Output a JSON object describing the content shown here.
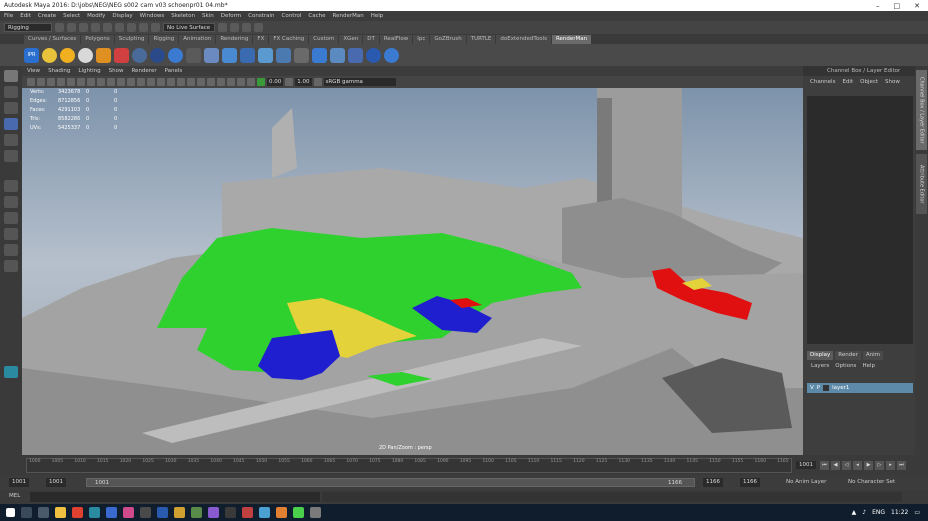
{
  "window": {
    "title": "Autodesk Maya 2016: D:\\jobs\\NEG\\NEG s002 cam v03 schoenpr01 04.mb*"
  },
  "menubar": [
    "File",
    "Edit",
    "Create",
    "Select",
    "Modify",
    "Display",
    "Windows",
    "Skeleton",
    "Skin",
    "Deform",
    "Constrain",
    "Control",
    "Cache",
    "RenderMan",
    "Help"
  ],
  "modebar": {
    "mode": "Rigging",
    "live_surface": "No Live Surface"
  },
  "shelf_tabs": [
    "Curves / Surfaces",
    "Polygons",
    "Sculpting",
    "Rigging",
    "Animation",
    "Rendering",
    "FX",
    "FX Caching",
    "Custom",
    "XGen",
    "DT",
    "RealFlow",
    "Ipc",
    "GoZBrush",
    "TURTLE",
    "doExtendedTools",
    "RenderMan"
  ],
  "shelf_active": "RenderMan",
  "shelf_ipr": "IPR",
  "viewport": {
    "menu": [
      "View",
      "Shading",
      "Lighting",
      "Show",
      "Renderer",
      "Panels"
    ],
    "exposure": "0.00",
    "gamma": "1.00",
    "color_space": "sRGB gamma",
    "hud": [
      {
        "label": "Verts:",
        "a": "3423678",
        "b": "0",
        "c": "0"
      },
      {
        "label": "Edges:",
        "a": "8712856",
        "b": "0",
        "c": "0"
      },
      {
        "label": "Faces:",
        "a": "4291103",
        "b": "0",
        "c": "0"
      },
      {
        "label": "Tris:",
        "a": "8582286",
        "b": "0",
        "c": "0"
      },
      {
        "label": "UVs:",
        "a": "5425337",
        "b": "0",
        "c": "0"
      }
    ],
    "camera_label": "2D Pan/Zoom : persp"
  },
  "channel_box": {
    "title": "Channel Box / Layer Editor",
    "menu": [
      "Channels",
      "Edit",
      "Object",
      "Show"
    ]
  },
  "layer_editor": {
    "tabs": [
      "Display",
      "Render",
      "Anim"
    ],
    "menu": [
      "Layers",
      "Options",
      "Help"
    ],
    "v": "V",
    "p": "P",
    "layer_name": "layer1"
  },
  "side_tabs": [
    "Channel Box / Layer Editor",
    "Attribute Editor"
  ],
  "timeline": {
    "ticks": [
      "1000",
      "1005",
      "1010",
      "1015",
      "1020",
      "1025",
      "1030",
      "1035",
      "1040",
      "1045",
      "1050",
      "1055",
      "1060",
      "1065",
      "1070",
      "1075",
      "1080",
      "1085",
      "1090",
      "1095",
      "1100",
      "1105",
      "1110",
      "1115",
      "1120",
      "1125",
      "1130",
      "1135",
      "1140",
      "1145",
      "1150",
      "1155",
      "1160",
      "1165"
    ],
    "current": "1001"
  },
  "range": {
    "start": "1001",
    "start_inner": "1001",
    "bar_start": "1001",
    "bar_end": "1166",
    "end_inner": "1166",
    "end": "1166",
    "anim_layer": "No Anim Layer",
    "char_set": "No Character Set"
  },
  "command": {
    "lang": "MEL"
  },
  "taskbar": {
    "lang": "ENG",
    "time": "11:22"
  },
  "colors": {
    "green": "#2fd12f",
    "yellow": "#e3d23a",
    "blue": "#1f1fd0",
    "red": "#e01010",
    "rock": "#9a9a9a",
    "sky_top": "#7d93ab"
  }
}
